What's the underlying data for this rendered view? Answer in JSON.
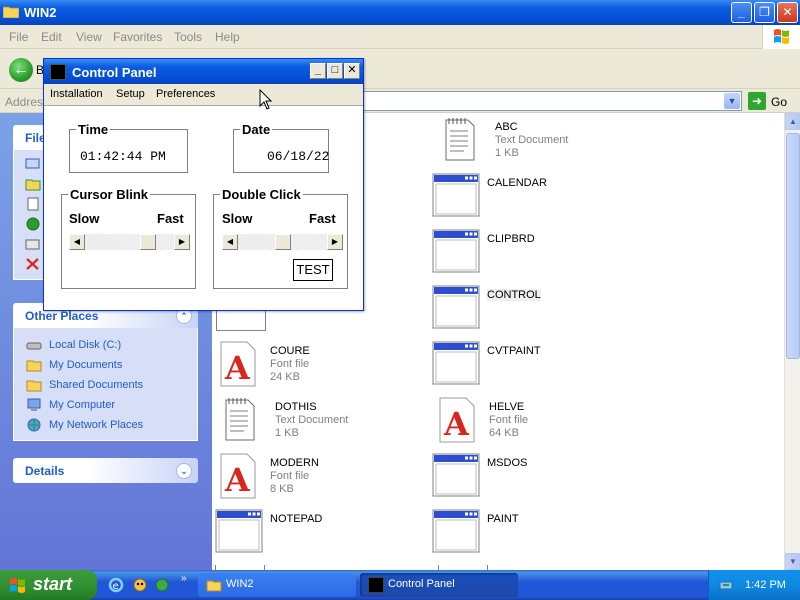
{
  "explorer": {
    "title": "WIN2",
    "menu": [
      "File",
      "Edit",
      "View",
      "Favorites",
      "Tools",
      "Help"
    ],
    "back_label": "B",
    "address_label": "Address",
    "go_label": "Go",
    "taskpane": {
      "file_tasks_header": "File",
      "other_places_header": "Other Places",
      "places": [
        {
          "label": "Local Disk (C:)",
          "icon": "drive-icon"
        },
        {
          "label": "My Documents",
          "icon": "folder-icon"
        },
        {
          "label": "Shared Documents",
          "icon": "folder-icon"
        },
        {
          "label": "My Computer",
          "icon": "computer-icon"
        },
        {
          "label": "My Network Places",
          "icon": "network-icon"
        }
      ],
      "details_header": "Details"
    },
    "items": [
      {
        "name": "ABC",
        "type": "Text Document",
        "size": "1 KB",
        "icon": "text-doc-icon"
      },
      {
        "name": "CALENDAR",
        "type": "",
        "size": "",
        "icon": "app-window-icon"
      },
      {
        "name": "CLIPBRD",
        "type": "",
        "size": "",
        "icon": "app-window-icon"
      },
      {
        "name": "CONTROL",
        "type": "",
        "size": "",
        "icon": "app-window-icon"
      },
      {
        "name": "COURE",
        "type": "Font file",
        "size": "24 KB",
        "icon": "font-file-icon"
      },
      {
        "name": "CVTPAINT",
        "type": "",
        "size": "",
        "icon": "app-window-icon"
      },
      {
        "name": "DOTHIS",
        "type": "Text Document",
        "size": "1 KB",
        "icon": "text-doc-icon"
      },
      {
        "name": "HELVE",
        "type": "Font file",
        "size": "64 KB",
        "icon": "font-file-icon"
      },
      {
        "name": "MODERN",
        "type": "Font file",
        "size": "8 KB",
        "icon": "font-file-icon"
      },
      {
        "name": "MSDOS",
        "type": "",
        "size": "",
        "icon": "app-window-icon"
      },
      {
        "name": "NOTEPAD",
        "type": "",
        "size": "",
        "icon": "app-window-icon"
      },
      {
        "name": "PAINT",
        "type": "",
        "size": "",
        "icon": "app-window-icon"
      }
    ]
  },
  "control_panel": {
    "title": "Control Panel",
    "menu": [
      "Installation",
      "Setup",
      "Preferences"
    ],
    "time_label": "Time",
    "time_value": "01:42:44 PM",
    "date_label": "Date",
    "date_value": "06/18/22",
    "cursor_blink": {
      "label": "Cursor Blink",
      "slow": "Slow",
      "fast": "Fast",
      "level": 0.75
    },
    "double_click": {
      "label": "Double Click",
      "slow": "Slow",
      "fast": "Fast",
      "level": 0.5
    },
    "test_label": "TEST"
  },
  "taskbar": {
    "start_label": "start",
    "tasks": [
      {
        "label": "WIN2",
        "icon": "folder-icon"
      },
      {
        "label": "Control Panel",
        "icon": "app-icon"
      }
    ],
    "clock": "1:42 PM"
  },
  "colors": {
    "title_blue": "#0a5ee0",
    "taskpane_blue": "#6375d6",
    "link_blue": "#215dc6",
    "start_green": "#2f8e2f"
  }
}
